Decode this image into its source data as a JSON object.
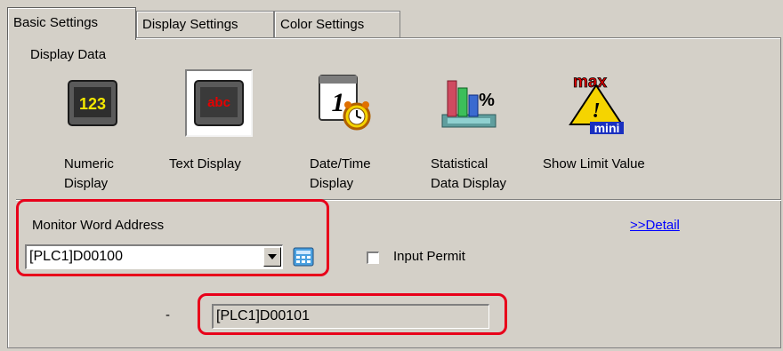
{
  "tabs": [
    {
      "label": "Basic Settings",
      "active": true
    },
    {
      "label": "Display Settings",
      "active": false
    },
    {
      "label": "Color Settings",
      "active": false
    }
  ],
  "display_data": {
    "heading": "Display Data",
    "items": [
      {
        "icon": "numeric-display-icon",
        "icon_text": "123",
        "label_line1": "Numeric",
        "label_line2": "Display",
        "selected": false
      },
      {
        "icon": "text-display-icon",
        "icon_text": "abc",
        "label_line1": "Text Display",
        "label_line2": "",
        "selected": true
      },
      {
        "icon": "date-time-display-icon",
        "icon_text": "1",
        "label_line1": "Date/Time",
        "label_line2": "Display",
        "selected": false
      },
      {
        "icon": "statistical-data-display-icon",
        "icon_text": "%",
        "label_line1": "Statistical",
        "label_line2": "Data Display",
        "selected": false
      },
      {
        "icon": "show-limit-value-icon",
        "icon_text_top": "max",
        "icon_text_mid": "!",
        "icon_text_bottom": "mini",
        "label_line1": "Show Limit Value",
        "label_line2": "",
        "selected": false
      }
    ]
  },
  "monitor": {
    "label": "Monitor Word Address",
    "value": "[PLC1]D00100",
    "detail_link": ">>Detail",
    "input_permit_label": "Input Permit",
    "input_permit_checked": false,
    "secondary_prefix": "-",
    "secondary_value": "[PLC1]D00101"
  },
  "colors": {
    "highlight": "#e8001a",
    "window": "#d4d0c8",
    "link": "#0000ff"
  }
}
